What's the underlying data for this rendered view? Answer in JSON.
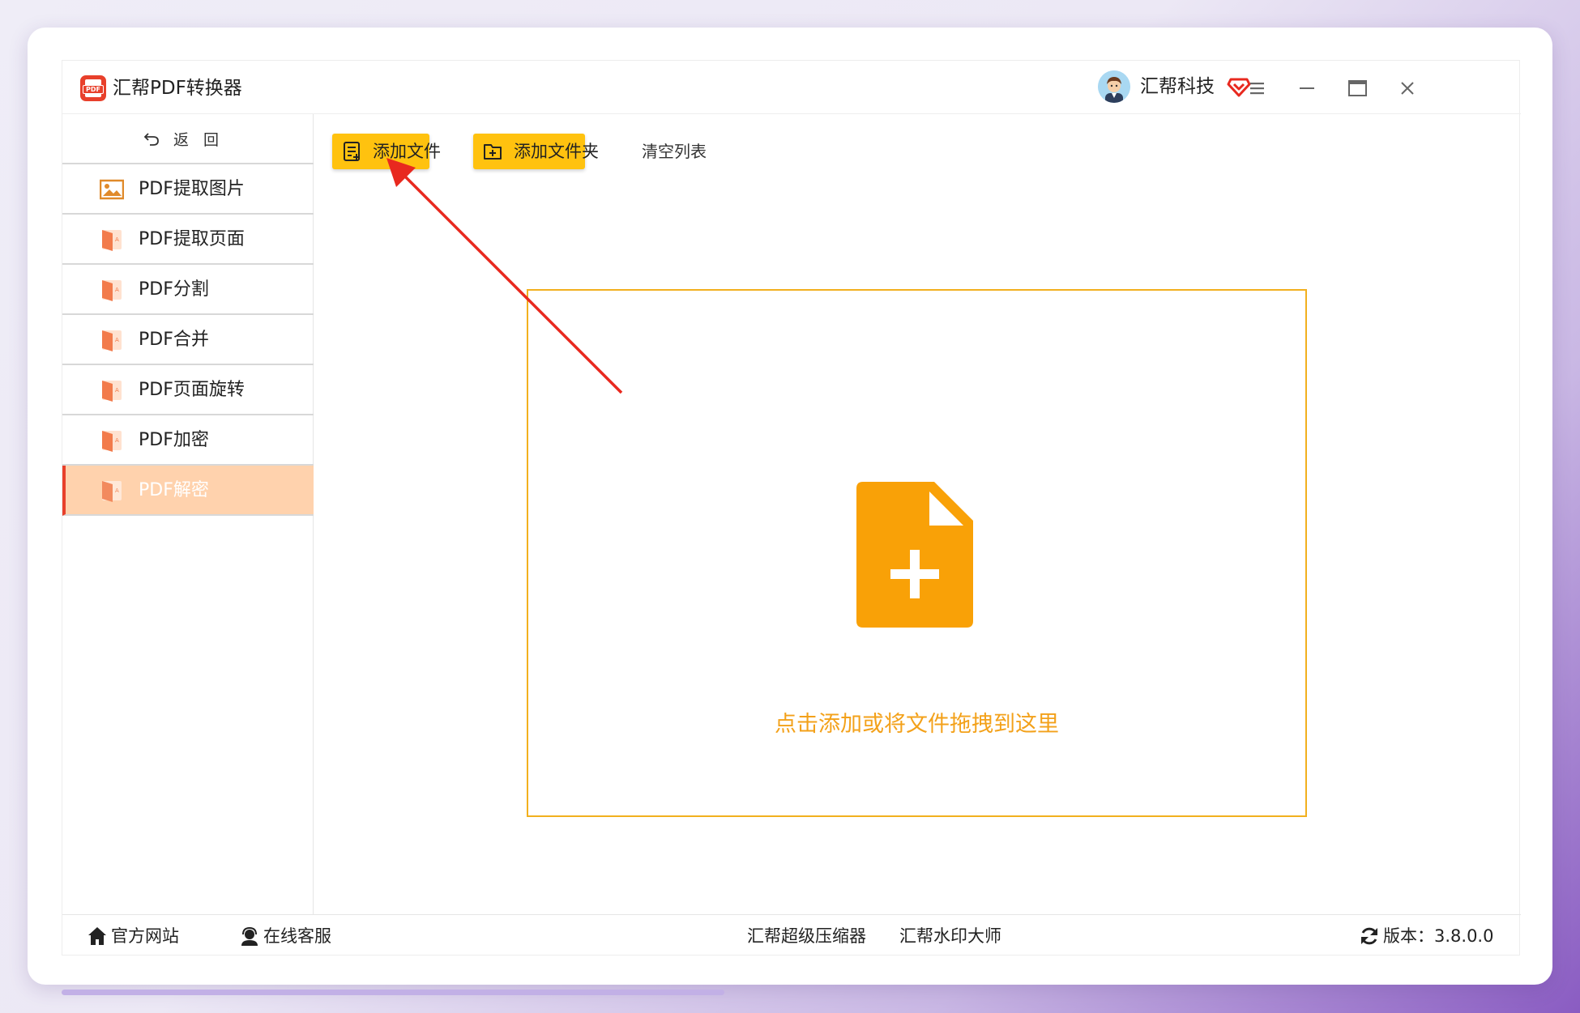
{
  "app": {
    "title": "汇帮PDF转换器",
    "logo_text": "PDF",
    "username": "汇帮科技"
  },
  "colors": {
    "accent": "#ffc20f",
    "brand": "#e8402b",
    "active_bg": "#ffd2ad",
    "drop_border": "#f2b01e",
    "drop_icon": "#f9a107",
    "drop_text": "#f3a11a",
    "arrow": "#e8291f"
  },
  "sidebar": {
    "back_label": "返回",
    "items": [
      {
        "label": "PDF提取图片",
        "icon": "image-icon"
      },
      {
        "label": "PDF提取页面",
        "icon": "pdf-doc-icon"
      },
      {
        "label": "PDF分割",
        "icon": "pdf-doc-icon"
      },
      {
        "label": "PDF合并",
        "icon": "pdf-doc-icon"
      },
      {
        "label": "PDF页面旋转",
        "icon": "pdf-doc-icon"
      },
      {
        "label": "PDF加密",
        "icon": "pdf-doc-icon"
      },
      {
        "label": "PDF解密",
        "icon": "pdf-doc-icon",
        "active": true
      }
    ]
  },
  "toolbar": {
    "add_file": "添加文件",
    "add_folder": "添加文件夹",
    "clear_list": "清空列表"
  },
  "dropzone": {
    "text": "点击添加或将文件拖拽到这里",
    "icon": "file-plus-icon"
  },
  "footer": {
    "website": "官方网站",
    "support": "在线客服",
    "compressor": "汇帮超级压缩器",
    "watermark": "汇帮水印大师",
    "version_label": "版本：3.8.0.0"
  }
}
